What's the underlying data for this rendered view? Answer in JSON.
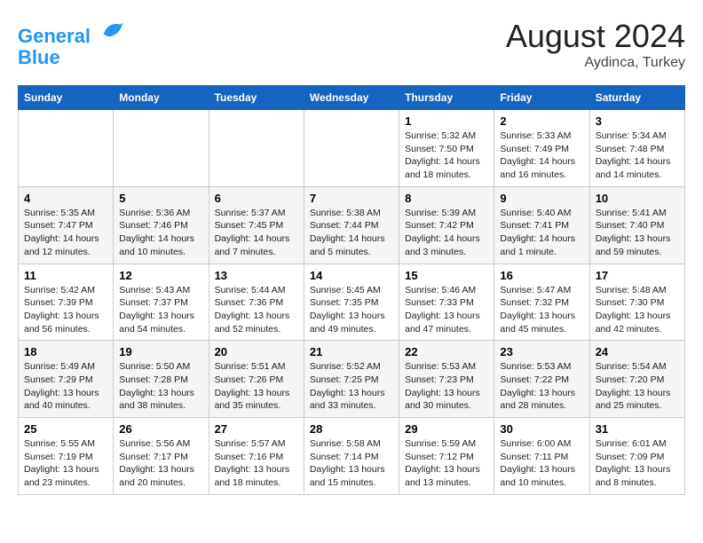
{
  "header": {
    "logo_line1": "General",
    "logo_line2": "Blue",
    "main_title": "August 2024",
    "sub_title": "Aydinca, Turkey"
  },
  "days_of_week": [
    "Sunday",
    "Monday",
    "Tuesday",
    "Wednesday",
    "Thursday",
    "Friday",
    "Saturday"
  ],
  "weeks": [
    [
      {
        "day": "",
        "info": ""
      },
      {
        "day": "",
        "info": ""
      },
      {
        "day": "",
        "info": ""
      },
      {
        "day": "",
        "info": ""
      },
      {
        "day": "1",
        "info": "Sunrise: 5:32 AM\nSunset: 7:50 PM\nDaylight: 14 hours\nand 18 minutes."
      },
      {
        "day": "2",
        "info": "Sunrise: 5:33 AM\nSunset: 7:49 PM\nDaylight: 14 hours\nand 16 minutes."
      },
      {
        "day": "3",
        "info": "Sunrise: 5:34 AM\nSunset: 7:48 PM\nDaylight: 14 hours\nand 14 minutes."
      }
    ],
    [
      {
        "day": "4",
        "info": "Sunrise: 5:35 AM\nSunset: 7:47 PM\nDaylight: 14 hours\nand 12 minutes."
      },
      {
        "day": "5",
        "info": "Sunrise: 5:36 AM\nSunset: 7:46 PM\nDaylight: 14 hours\nand 10 minutes."
      },
      {
        "day": "6",
        "info": "Sunrise: 5:37 AM\nSunset: 7:45 PM\nDaylight: 14 hours\nand 7 minutes."
      },
      {
        "day": "7",
        "info": "Sunrise: 5:38 AM\nSunset: 7:44 PM\nDaylight: 14 hours\nand 5 minutes."
      },
      {
        "day": "8",
        "info": "Sunrise: 5:39 AM\nSunset: 7:42 PM\nDaylight: 14 hours\nand 3 minutes."
      },
      {
        "day": "9",
        "info": "Sunrise: 5:40 AM\nSunset: 7:41 PM\nDaylight: 14 hours\nand 1 minute."
      },
      {
        "day": "10",
        "info": "Sunrise: 5:41 AM\nSunset: 7:40 PM\nDaylight: 13 hours\nand 59 minutes."
      }
    ],
    [
      {
        "day": "11",
        "info": "Sunrise: 5:42 AM\nSunset: 7:39 PM\nDaylight: 13 hours\nand 56 minutes."
      },
      {
        "day": "12",
        "info": "Sunrise: 5:43 AM\nSunset: 7:37 PM\nDaylight: 13 hours\nand 54 minutes."
      },
      {
        "day": "13",
        "info": "Sunrise: 5:44 AM\nSunset: 7:36 PM\nDaylight: 13 hours\nand 52 minutes."
      },
      {
        "day": "14",
        "info": "Sunrise: 5:45 AM\nSunset: 7:35 PM\nDaylight: 13 hours\nand 49 minutes."
      },
      {
        "day": "15",
        "info": "Sunrise: 5:46 AM\nSunset: 7:33 PM\nDaylight: 13 hours\nand 47 minutes."
      },
      {
        "day": "16",
        "info": "Sunrise: 5:47 AM\nSunset: 7:32 PM\nDaylight: 13 hours\nand 45 minutes."
      },
      {
        "day": "17",
        "info": "Sunrise: 5:48 AM\nSunset: 7:30 PM\nDaylight: 13 hours\nand 42 minutes."
      }
    ],
    [
      {
        "day": "18",
        "info": "Sunrise: 5:49 AM\nSunset: 7:29 PM\nDaylight: 13 hours\nand 40 minutes."
      },
      {
        "day": "19",
        "info": "Sunrise: 5:50 AM\nSunset: 7:28 PM\nDaylight: 13 hours\nand 38 minutes."
      },
      {
        "day": "20",
        "info": "Sunrise: 5:51 AM\nSunset: 7:26 PM\nDaylight: 13 hours\nand 35 minutes."
      },
      {
        "day": "21",
        "info": "Sunrise: 5:52 AM\nSunset: 7:25 PM\nDaylight: 13 hours\nand 33 minutes."
      },
      {
        "day": "22",
        "info": "Sunrise: 5:53 AM\nSunset: 7:23 PM\nDaylight: 13 hours\nand 30 minutes."
      },
      {
        "day": "23",
        "info": "Sunrise: 5:53 AM\nSunset: 7:22 PM\nDaylight: 13 hours\nand 28 minutes."
      },
      {
        "day": "24",
        "info": "Sunrise: 5:54 AM\nSunset: 7:20 PM\nDaylight: 13 hours\nand 25 minutes."
      }
    ],
    [
      {
        "day": "25",
        "info": "Sunrise: 5:55 AM\nSunset: 7:19 PM\nDaylight: 13 hours\nand 23 minutes."
      },
      {
        "day": "26",
        "info": "Sunrise: 5:56 AM\nSunset: 7:17 PM\nDaylight: 13 hours\nand 20 minutes."
      },
      {
        "day": "27",
        "info": "Sunrise: 5:57 AM\nSunset: 7:16 PM\nDaylight: 13 hours\nand 18 minutes."
      },
      {
        "day": "28",
        "info": "Sunrise: 5:58 AM\nSunset: 7:14 PM\nDaylight: 13 hours\nand 15 minutes."
      },
      {
        "day": "29",
        "info": "Sunrise: 5:59 AM\nSunset: 7:12 PM\nDaylight: 13 hours\nand 13 minutes."
      },
      {
        "day": "30",
        "info": "Sunrise: 6:00 AM\nSunset: 7:11 PM\nDaylight: 13 hours\nand 10 minutes."
      },
      {
        "day": "31",
        "info": "Sunrise: 6:01 AM\nSunset: 7:09 PM\nDaylight: 13 hours\nand 8 minutes."
      }
    ]
  ]
}
